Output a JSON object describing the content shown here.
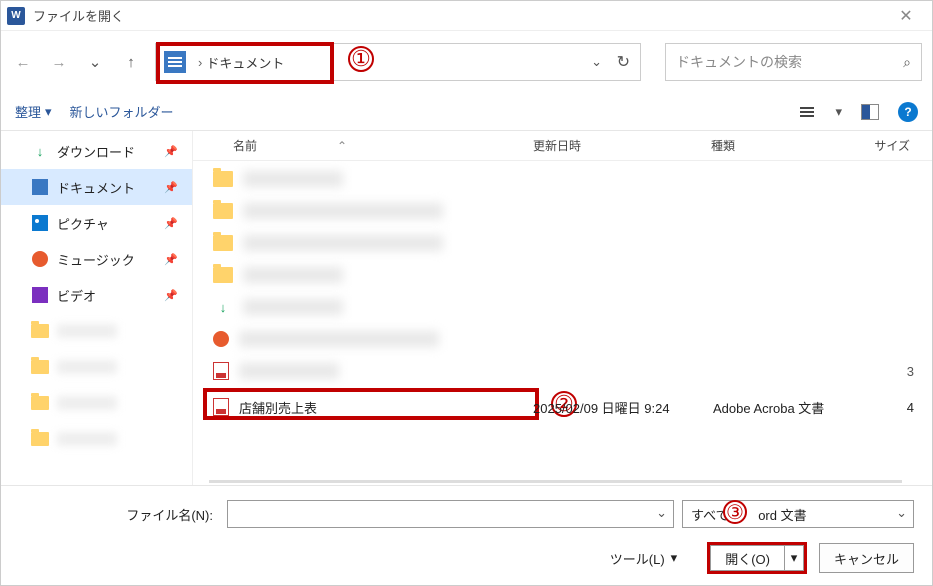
{
  "title": "ファイルを開く",
  "app_icon_letter": "W",
  "nav": {
    "path_label": "ドキュメント",
    "path_sep": "›",
    "refresh_icon": "↻",
    "dropdown_icon": "⌄"
  },
  "search": {
    "placeholder": "ドキュメントの検索"
  },
  "annotations": {
    "a1": "①",
    "a2": "②",
    "a3": "③"
  },
  "toolbar": {
    "organize": "整理",
    "new_folder": "新しいフォルダー",
    "help": "?"
  },
  "sidebar": {
    "items": [
      {
        "label": "ダウンロード",
        "icon": "download",
        "pin": true
      },
      {
        "label": "ドキュメント",
        "icon": "document",
        "pin": true,
        "selected": true
      },
      {
        "label": "ピクチャ",
        "icon": "picture",
        "pin": true
      },
      {
        "label": "ミュージック",
        "icon": "music",
        "pin": true
      },
      {
        "label": "ビデオ",
        "icon": "video",
        "pin": true
      },
      {
        "label": "",
        "icon": "folder",
        "pin": false,
        "blur": true
      },
      {
        "label": "",
        "icon": "folder",
        "pin": false,
        "blur": true
      },
      {
        "label": "",
        "icon": "folder",
        "pin": false,
        "blur": true
      },
      {
        "label": "",
        "icon": "folder",
        "pin": false,
        "blur": true
      }
    ]
  },
  "columns": {
    "name": "名前",
    "date": "更新日時",
    "type": "種類",
    "size": "サイズ",
    "sort_caret": "⌃"
  },
  "files": {
    "blurred_rows": [
      {
        "icon": "folder"
      },
      {
        "icon": "folder"
      },
      {
        "icon": "folder"
      },
      {
        "icon": "folder"
      },
      {
        "icon": "download"
      },
      {
        "icon": "music"
      },
      {
        "icon": "pdf",
        "right": "3"
      }
    ],
    "selected": {
      "name": "店舗別売上表",
      "date": "2025/02/09 日曜日 9:24",
      "type": "Adobe Acroba 文書",
      "size": "4"
    }
  },
  "bottom": {
    "filename_label": "ファイル名(N):",
    "filetype_pre": "すべて",
    "filetype_post": "ord 文書",
    "tools": "ツール(L)",
    "open": "開く(O)",
    "cancel": "キャンセル"
  }
}
